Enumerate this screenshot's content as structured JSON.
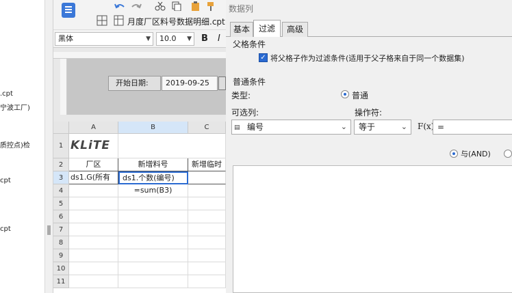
{
  "file_tree": {
    "items": [
      ".cpt",
      "宁波工厂)",
      "质控点)检",
      "cpt",
      "cpt"
    ]
  },
  "toolbar": {
    "tab_title": "月度厂区料号数据明细.cpt",
    "font_name": "黑体",
    "font_size": "10.0",
    "bold_label": "B",
    "italic_label": "I"
  },
  "params": {
    "start_label": "开始日期:",
    "start_value": "2019-09-25"
  },
  "grid": {
    "columns": [
      "A",
      "B",
      "C"
    ],
    "rows": [
      "1",
      "2",
      "3",
      "4",
      "5",
      "6",
      "7",
      "8",
      "9",
      "10",
      "11"
    ],
    "logo": "KLiTE",
    "cells": {
      "A2": "厂区",
      "B2": "新增料号",
      "C2": "新增临时",
      "A3": "ds1.G(所有",
      "B3": "ds1.个数(编号)",
      "B4": "=sum(B3)"
    }
  },
  "dialog": {
    "title": "数据列",
    "tabs": [
      "基本",
      "过滤",
      "高级"
    ],
    "active_tab": "过滤",
    "parent_section": "父格条件",
    "parent_checkbox_label": "将父格子作为过滤条件(适用于父子格来自于同一个数据集)",
    "normal_section": "普通条件",
    "type_label": "类型:",
    "type_option_normal": "普通",
    "selectable_label": "可选列:",
    "operator_label": "操作符:",
    "column_value": "编号",
    "operator_value": "等于",
    "fx_label": "F(x)",
    "value_field": "=",
    "and_label": "与(AND)"
  },
  "colors": {
    "accent": "#2a6ad1",
    "selection": "#2a6ad1"
  }
}
